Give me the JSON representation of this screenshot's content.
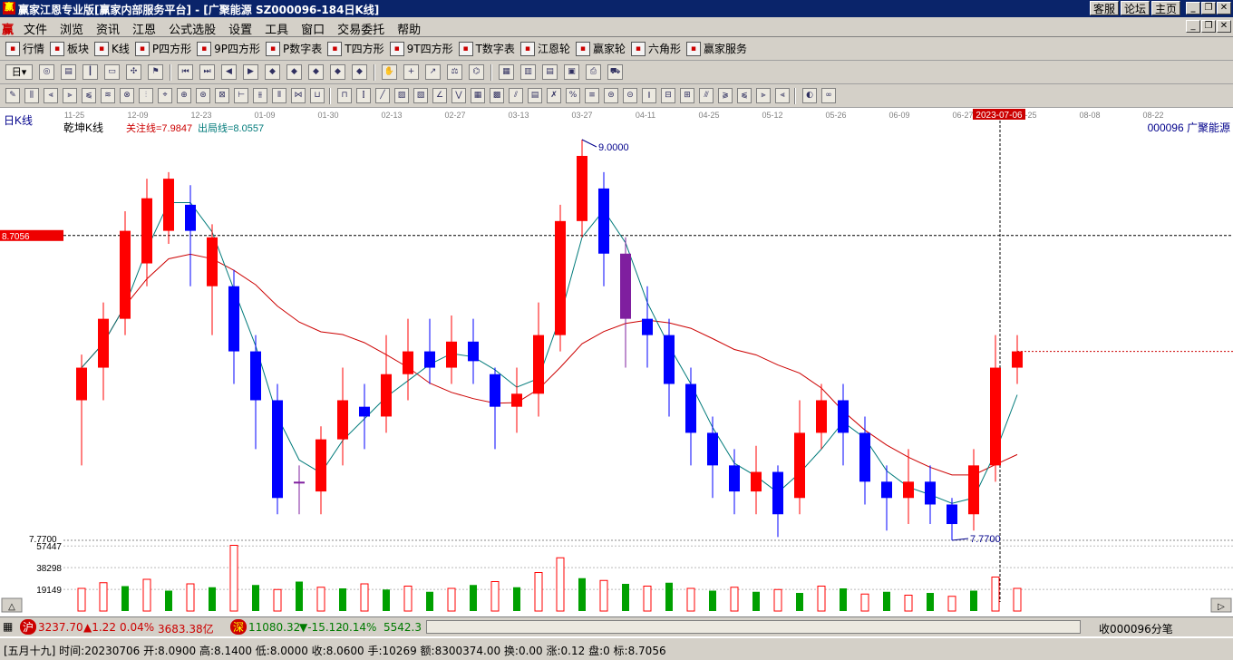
{
  "window": {
    "title": "赢家江恩专业版[赢家内部服务平台] - [广聚能源   SZ000096-184日K线]",
    "links": [
      "客服",
      "论坛",
      "主页"
    ],
    "controls": [
      "_",
      "❐",
      "✕"
    ]
  },
  "menu": {
    "items": [
      "文件",
      "浏览",
      "资讯",
      "江恩",
      "公式选股",
      "设置",
      "工具",
      "窗口",
      "交易委托",
      "帮助"
    ]
  },
  "toolbar1": [
    {
      "icon": "table-icon",
      "label": "行情"
    },
    {
      "icon": "grid-icon",
      "label": "板块"
    },
    {
      "icon": "candle-icon",
      "label": "K线"
    },
    {
      "icon": "ps-icon",
      "label": "P四方形"
    },
    {
      "icon": "p9-icon",
      "label": "9P四方形"
    },
    {
      "icon": "pn-icon",
      "label": "P数字表"
    },
    {
      "icon": "ts-icon",
      "label": "T四方形"
    },
    {
      "icon": "t9-icon",
      "label": "9T四方形"
    },
    {
      "icon": "tn-icon",
      "label": "T数字表"
    },
    {
      "icon": "wheel-icon",
      "label": "江恩轮"
    },
    {
      "icon": "winner-wheel-icon",
      "label": "赢家轮"
    },
    {
      "icon": "hexagon-icon",
      "label": "六角形"
    },
    {
      "icon": "dollar-icon",
      "label": "赢家服务"
    }
  ],
  "toolbar2": {
    "period": "日"
  },
  "chart": {
    "panel_label": "日K线",
    "indicator_name": "乾坤K线",
    "focus_line": "关注线=7.9847",
    "exit_line": "出局线=8.0557",
    "stock_label": "000096 广聚能源",
    "crosshair_price": "8.7056",
    "crosshair_date": "2023-07-06",
    "high_label": "9.0000",
    "low_label": "7.7700",
    "y_low": "7.7700",
    "vol_ticks": [
      "57447",
      "38298",
      "19149"
    ],
    "dates": [
      "11-25",
      "12-09",
      "12-23",
      "01-09",
      "01-30",
      "02-13",
      "02-27",
      "03-13",
      "03-27",
      "04-11",
      "04-25",
      "05-12",
      "05-26",
      "06-09",
      "06-27",
      "07-25",
      "08-08",
      "08-22"
    ],
    "colors": {
      "up": "#ff0000",
      "down": "#0000ff",
      "neutral": "#7f1f9f",
      "vol_up": "#ff0000",
      "vol_down": "#00a000",
      "ma_fast": "#007a7a",
      "ma_slow": "#cc0000"
    }
  },
  "chart_data": {
    "type": "candlestick",
    "price_range": [
      7.77,
      9.0
    ],
    "candles": [
      [
        8.2,
        8.3,
        8.34,
        8.0,
        "up"
      ],
      [
        8.3,
        8.45,
        8.5,
        8.2,
        "up"
      ],
      [
        8.45,
        8.72,
        8.78,
        8.4,
        "up"
      ],
      [
        8.62,
        8.82,
        8.88,
        8.55,
        "up"
      ],
      [
        8.72,
        8.88,
        8.9,
        8.68,
        "up"
      ],
      [
        8.8,
        8.72,
        8.86,
        8.55,
        "down"
      ],
      [
        8.7,
        8.55,
        8.74,
        8.4,
        "up"
      ],
      [
        8.55,
        8.35,
        8.6,
        8.25,
        "down"
      ],
      [
        8.35,
        8.2,
        8.4,
        8.05,
        "down"
      ],
      [
        8.2,
        7.9,
        8.25,
        7.85,
        "down"
      ],
      [
        7.95,
        7.95,
        8.0,
        7.85,
        "neutral"
      ],
      [
        7.92,
        8.08,
        8.12,
        7.85,
        "up"
      ],
      [
        8.08,
        8.2,
        8.3,
        8.0,
        "up"
      ],
      [
        8.18,
        8.15,
        8.25,
        8.05,
        "down"
      ],
      [
        8.15,
        8.28,
        8.4,
        8.1,
        "up"
      ],
      [
        8.28,
        8.35,
        8.45,
        8.2,
        "up"
      ],
      [
        8.35,
        8.3,
        8.45,
        8.25,
        "down"
      ],
      [
        8.3,
        8.38,
        8.46,
        8.25,
        "up"
      ],
      [
        8.38,
        8.32,
        8.45,
        8.25,
        "down"
      ],
      [
        8.28,
        8.18,
        8.3,
        8.05,
        "down"
      ],
      [
        8.18,
        8.22,
        8.3,
        8.1,
        "up"
      ],
      [
        8.22,
        8.4,
        8.5,
        8.15,
        "up"
      ],
      [
        8.4,
        8.75,
        8.8,
        8.35,
        "up"
      ],
      [
        8.75,
        8.95,
        9.0,
        8.7,
        "up"
      ],
      [
        8.85,
        8.65,
        8.9,
        8.55,
        "down"
      ],
      [
        8.65,
        8.45,
        8.7,
        8.3,
        "neutral"
      ],
      [
        8.45,
        8.4,
        8.55,
        8.3,
        "down"
      ],
      [
        8.4,
        8.25,
        8.45,
        8.15,
        "down"
      ],
      [
        8.25,
        8.1,
        8.3,
        8.0,
        "down"
      ],
      [
        8.1,
        8.0,
        8.15,
        7.9,
        "down"
      ],
      [
        8.0,
        7.92,
        8.05,
        7.85,
        "down"
      ],
      [
        7.92,
        7.98,
        8.06,
        7.85,
        "up"
      ],
      [
        7.98,
        7.85,
        8.0,
        7.78,
        "down"
      ],
      [
        7.9,
        8.1,
        8.2,
        7.85,
        "up"
      ],
      [
        8.1,
        8.2,
        8.25,
        8.05,
        "up"
      ],
      [
        8.2,
        8.1,
        8.25,
        8.0,
        "down"
      ],
      [
        8.1,
        7.95,
        8.15,
        7.88,
        "down"
      ],
      [
        7.95,
        7.9,
        8.0,
        7.8,
        "down"
      ],
      [
        7.9,
        7.95,
        8.05,
        7.82,
        "up"
      ],
      [
        7.95,
        7.88,
        8.0,
        7.82,
        "down"
      ],
      [
        7.88,
        7.82,
        7.9,
        7.77,
        "down"
      ],
      [
        7.85,
        8.0,
        8.05,
        7.8,
        "up"
      ],
      [
        8.0,
        8.3,
        8.4,
        7.95,
        "up"
      ],
      [
        8.3,
        8.35,
        8.4,
        8.25,
        "up"
      ]
    ],
    "volume": [
      [
        20000,
        "up"
      ],
      [
        25000,
        "up"
      ],
      [
        22000,
        "down"
      ],
      [
        28000,
        "up"
      ],
      [
        18000,
        "down"
      ],
      [
        24000,
        "up"
      ],
      [
        21000,
        "down"
      ],
      [
        58000,
        "up"
      ],
      [
        23000,
        "down"
      ],
      [
        19000,
        "up"
      ],
      [
        26000,
        "down"
      ],
      [
        21000,
        "up"
      ],
      [
        20000,
        "down"
      ],
      [
        24000,
        "up"
      ],
      [
        19000,
        "down"
      ],
      [
        22000,
        "up"
      ],
      [
        17000,
        "down"
      ],
      [
        20000,
        "up"
      ],
      [
        23000,
        "down"
      ],
      [
        26000,
        "up"
      ],
      [
        21000,
        "down"
      ],
      [
        34000,
        "up"
      ],
      [
        47000,
        "up"
      ],
      [
        29000,
        "down"
      ],
      [
        27000,
        "up"
      ],
      [
        24000,
        "down"
      ],
      [
        22000,
        "up"
      ],
      [
        25000,
        "down"
      ],
      [
        20000,
        "up"
      ],
      [
        18000,
        "down"
      ],
      [
        21000,
        "up"
      ],
      [
        17000,
        "down"
      ],
      [
        19000,
        "up"
      ],
      [
        16000,
        "down"
      ],
      [
        22000,
        "up"
      ],
      [
        20000,
        "down"
      ],
      [
        15000,
        "up"
      ],
      [
        17000,
        "down"
      ],
      [
        14000,
        "up"
      ],
      [
        16000,
        "down"
      ],
      [
        13000,
        "up"
      ],
      [
        18000,
        "down"
      ],
      [
        30000,
        "up"
      ],
      [
        20000,
        "up"
      ]
    ]
  },
  "status1": {
    "sh_badge": "沪",
    "sh_index": "3237.70",
    "sh_change": "▲1.22",
    "sh_pct": "0.04%",
    "sh_amount": "3683.38亿",
    "sz_badge": "深",
    "sz_index": "11080.32",
    "sz_change": "▼-15.12",
    "sz_pct": "-0.14%",
    "sz_amount": "5542.3",
    "right": "收000096分笔"
  },
  "status2": {
    "text": "[五月十九] 时间:20230706 开:8.0900 高:8.1400 低:8.0000 收:8.0600 手:10269 额:8300374.00 换:0.00 涨:0.12 盘:0 标:8.7056"
  }
}
